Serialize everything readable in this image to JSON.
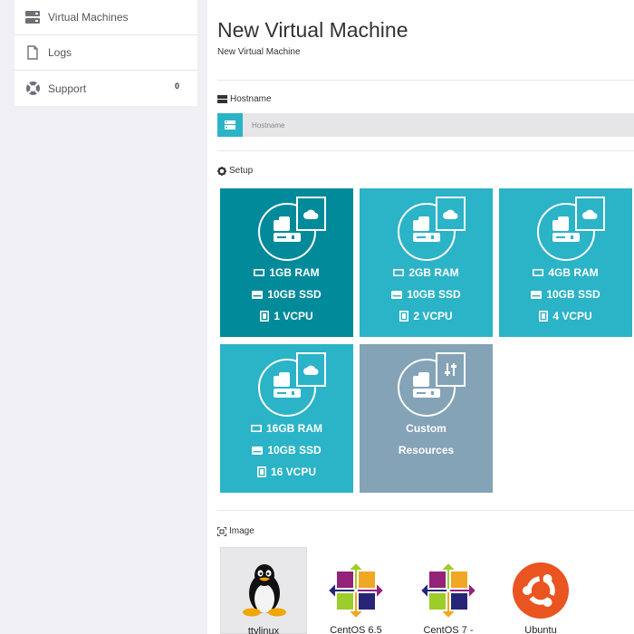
{
  "sidebar": {
    "items": [
      {
        "label": "Virtual Machines",
        "icon": "server-icon"
      },
      {
        "label": "Logs",
        "icon": "file-icon"
      },
      {
        "label": "Support",
        "icon": "lifebuoy-icon",
        "badge": "0"
      }
    ]
  },
  "header": {
    "title": "New Virtual Machine",
    "subtitle": "New Virtual Machine"
  },
  "hostname": {
    "label": "Hostname",
    "placeholder": "Hostname",
    "value": ""
  },
  "setup": {
    "label": "Setup",
    "plans": [
      {
        "ram": "1GB RAM",
        "disk": "10GB SSD",
        "cpu": "1 VCPU",
        "selected": true
      },
      {
        "ram": "2GB RAM",
        "disk": "10GB SSD",
        "cpu": "2 VCPU",
        "selected": false
      },
      {
        "ram": "4GB RAM",
        "disk": "10GB SSD",
        "cpu": "4 VCPU",
        "selected": false
      },
      {
        "ram": "16GB RAM",
        "disk": "10GB SSD",
        "cpu": "16 VCPU",
        "selected": false
      }
    ],
    "custom": {
      "line1": "Custom",
      "line2": "Resources"
    }
  },
  "image": {
    "label": "Image",
    "options": [
      {
        "label": "ttylinux",
        "icon": "tux-penguin-icon",
        "selected": true
      },
      {
        "label": "CentOS 6.5",
        "icon": "centos-logo-icon",
        "selected": false
      },
      {
        "label": "CentOS 7 -",
        "icon": "centos-logo-icon",
        "selected": false
      },
      {
        "label": "Ubuntu",
        "icon": "ubuntu-logo-icon",
        "selected": false
      }
    ]
  },
  "colors": {
    "tile": "#2bb3c7",
    "tile_selected": "#008a9a",
    "tile_custom": "#84a3b7",
    "ubuntu": "#e95420"
  }
}
